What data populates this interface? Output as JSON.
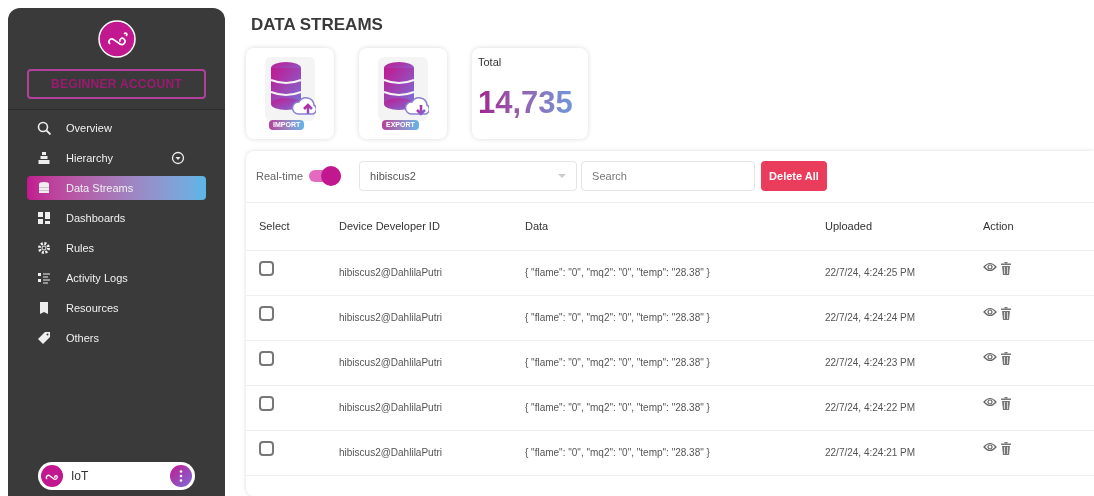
{
  "sidebar": {
    "account_badge": "BEGINNER ACCOUNT",
    "items": [
      {
        "label": "Overview",
        "selected": false,
        "dropdown": false
      },
      {
        "label": "Hierarchy",
        "selected": false,
        "dropdown": true
      },
      {
        "label": "Data Streams",
        "selected": true,
        "dropdown": false
      },
      {
        "label": "Dashboards",
        "selected": false,
        "dropdown": false
      },
      {
        "label": "Rules",
        "selected": false,
        "dropdown": false
      },
      {
        "label": "Activity Logs",
        "selected": false,
        "dropdown": false
      },
      {
        "label": "Resources",
        "selected": false,
        "dropdown": false
      },
      {
        "label": "Others",
        "selected": false,
        "dropdown": false
      }
    ],
    "workspace": {
      "name": "IoT"
    }
  },
  "page_title": "DATA STREAMS",
  "cards": [
    {
      "kind": "import",
      "label": "IMPORT"
    },
    {
      "kind": "export",
      "label": "EXPORT"
    },
    {
      "kind": "total",
      "title": "Total",
      "value": "14,735"
    }
  ],
  "filters": {
    "realtime_label": "Real-time",
    "realtime_on": true,
    "device": "hibiscus2",
    "search": {
      "placeholder": "Search"
    },
    "delete_button": "Delete All"
  },
  "table": {
    "columns": [
      "Select",
      "Device Developer ID",
      "Data",
      "Uploaded",
      "Action"
    ],
    "rows": [
      {
        "checked": false,
        "device": "hibiscus2@DahlilaPutri",
        "data": "{ \"flame\": \"0\", \"mq2\": \"0\", \"temp\": \"28.38\" }",
        "uploaded": "22/7/24, 4:24:25 PM"
      },
      {
        "checked": false,
        "device": "hibiscus2@DahlilaPutri",
        "data": "{ \"flame\": \"0\", \"mq2\": \"0\", \"temp\": \"28.38\" }",
        "uploaded": "22/7/24, 4:24:24 PM"
      },
      {
        "checked": false,
        "device": "hibiscus2@DahlilaPutri",
        "data": "{ \"flame\": \"0\", \"mq2\": \"0\", \"temp\": \"28.38\" }",
        "uploaded": "22/7/24, 4:24:23 PM"
      },
      {
        "checked": false,
        "device": "hibiscus2@DahlilaPutri",
        "data": "{ \"flame\": \"0\", \"mq2\": \"0\", \"temp\": \"28.38\" }",
        "uploaded": "22/7/24, 4:24:22 PM"
      },
      {
        "checked": false,
        "device": "hibiscus2@DahlilaPutri",
        "data": "{ \"flame\": \"0\", \"mq2\": \"0\", \"temp\": \"28.38\" }",
        "uploaded": "22/7/24, 4:24:21 PM"
      }
    ]
  }
}
